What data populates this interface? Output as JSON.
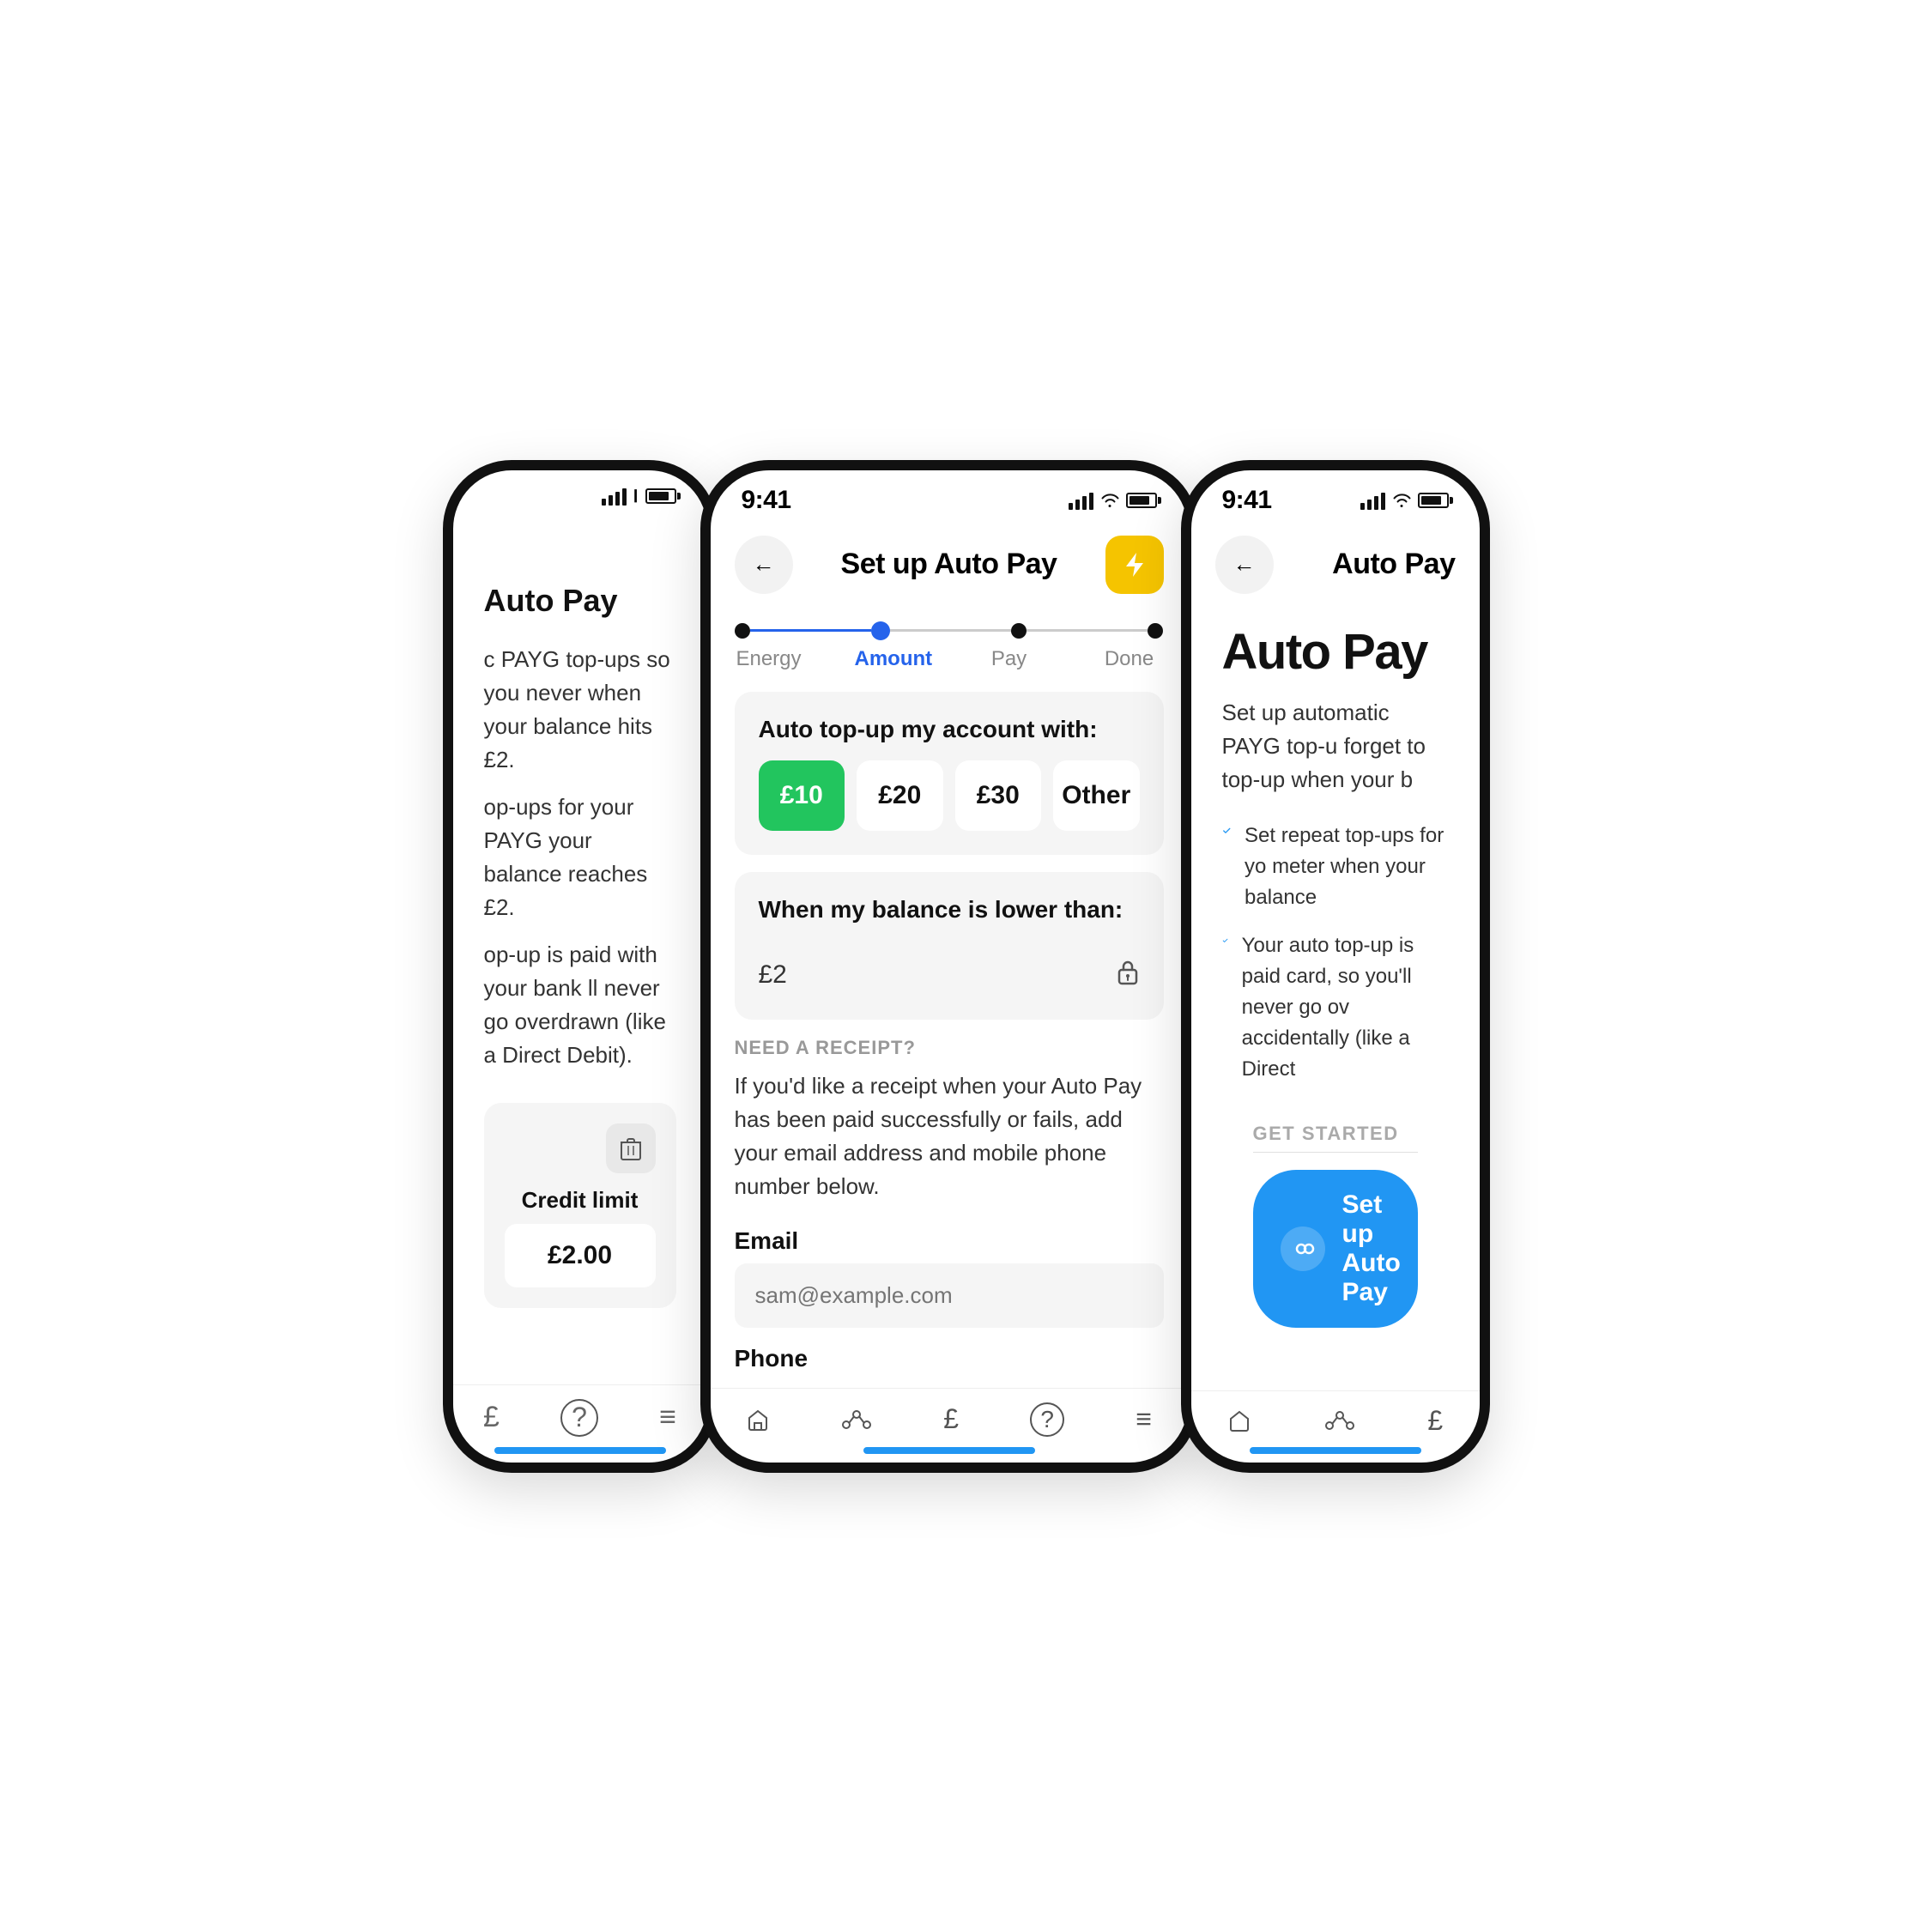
{
  "left_phone": {
    "title": "Auto Pay",
    "description_1": "c PAYG top-ups so you never when your balance hits £2.",
    "description_2": "op-ups for your PAYG your balance reaches £2.",
    "description_3": "op-up is paid with your bank ll never go overdrawn (like a Direct Debit).",
    "credit_limit_label": "Credit limit",
    "credit_value": "£2.00",
    "nav_items": [
      "£",
      "?",
      "≡"
    ]
  },
  "center_phone": {
    "status_time": "9:41",
    "header_title": "Set up Auto Pay",
    "steps": [
      {
        "label": "Energy",
        "active": false
      },
      {
        "label": "Amount",
        "active": true
      },
      {
        "label": "Pay",
        "active": false
      },
      {
        "label": "Done",
        "active": false
      }
    ],
    "auto_topup": {
      "section_title": "Auto top-up my account with:",
      "options": [
        {
          "label": "£10",
          "selected": true
        },
        {
          "label": "£20",
          "selected": false
        },
        {
          "label": "£30",
          "selected": false
        },
        {
          "label": "Other",
          "selected": false
        }
      ]
    },
    "balance": {
      "section_title": "When my balance is lower than:",
      "value": "£2"
    },
    "receipt": {
      "label": "NEED A RECEIPT?",
      "text": "If you'd like a receipt when your Auto Pay has been paid successfully or fails, add your email address and mobile phone number below.",
      "email_label": "Email",
      "email_placeholder": "sam@example.com",
      "phone_label": "Phone"
    },
    "nav_items": [
      "🏠",
      "⚙",
      "£",
      "?",
      "≡"
    ]
  },
  "right_phone": {
    "status_time": "9:41",
    "header_title": "Auto Pay",
    "page_title": "Auto Pay",
    "subtitle": "Set up automatic PAYG top-u forget to top-up when your b",
    "features": [
      "Set repeat top-ups for yo meter when your balance",
      "Your auto top-up is paid card, so you'll never go ov accidentally (like a Direct"
    ],
    "get_started_label": "GET STARTED",
    "setup_button_label": "Set up Auto Pay",
    "nav_items": [
      "🏠",
      "⚙",
      "£"
    ]
  }
}
